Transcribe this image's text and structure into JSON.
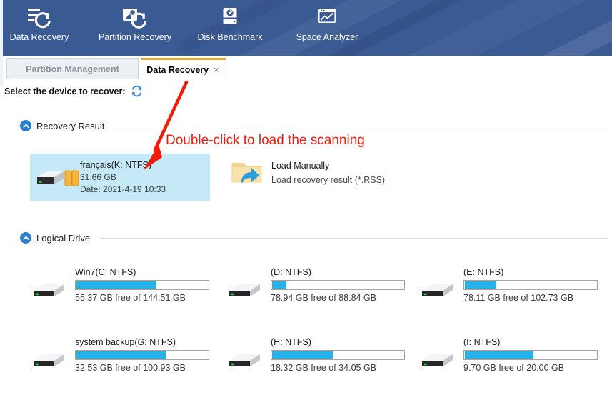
{
  "header": {
    "tools": [
      {
        "label": "Data Recovery",
        "icon": "data-recovery-icon"
      },
      {
        "label": "Partition Recovery",
        "icon": "partition-recovery-icon"
      },
      {
        "label": "Disk Benchmark",
        "icon": "disk-benchmark-icon"
      },
      {
        "label": "Space Analyzer",
        "icon": "space-analyzer-icon"
      }
    ],
    "background_color": "#3a5a94"
  },
  "tabs": [
    {
      "label": "Partition Management",
      "active": false
    },
    {
      "label": "Data Recovery",
      "active": true,
      "close_label": "×",
      "accent_color": "#f0a62c"
    }
  ],
  "toolbar_row": {
    "select_label": "Select the device to recover:",
    "refresh_icon": "refresh-icon"
  },
  "sections": {
    "recovery_result": {
      "title": "Recovery Result",
      "chevron_icon": "chevron-up-icon",
      "item": {
        "title": "français(K: NTFS)",
        "size": "31.66 GB",
        "date": "Date: 2021-4-19 10:33",
        "selected_color": "#c5e9f7"
      },
      "load_manually": {
        "title": "Load Manually",
        "subtitle": "Load recovery result (*.RSS)",
        "icon": "folder-import-icon"
      }
    },
    "logical_drive": {
      "title": "Logical Drive",
      "chevron_icon": "chevron-up-icon",
      "drives": [
        {
          "name": "Win7(C: NTFS)",
          "info": "55.37 GB free of 144.51 GB",
          "used_percent": 61
        },
        {
          "name": "(D: NTFS)",
          "info": "78.94 GB free of 88.84 GB",
          "used_percent": 11
        },
        {
          "name": "(E: NTFS)",
          "info": "78.11 GB free of 102.73 GB",
          "used_percent": 24
        },
        {
          "name": "system backup(G: NTFS)",
          "info": "32.53 GB free of 100.93 GB",
          "used_percent": 68
        },
        {
          "name": "(H: NTFS)",
          "info": "18.32 GB free of 34.05 GB",
          "used_percent": 46
        },
        {
          "name": "(I: NTFS)",
          "info": "9.70 GB free of 20.00 GB",
          "used_percent": 52
        }
      ],
      "bar_fill_color": "#25b1ea"
    }
  },
  "annotation": {
    "text": "Double-click to load the scanning",
    "color": "#f01d0c",
    "arrow_icon": "red-arrow-icon"
  }
}
